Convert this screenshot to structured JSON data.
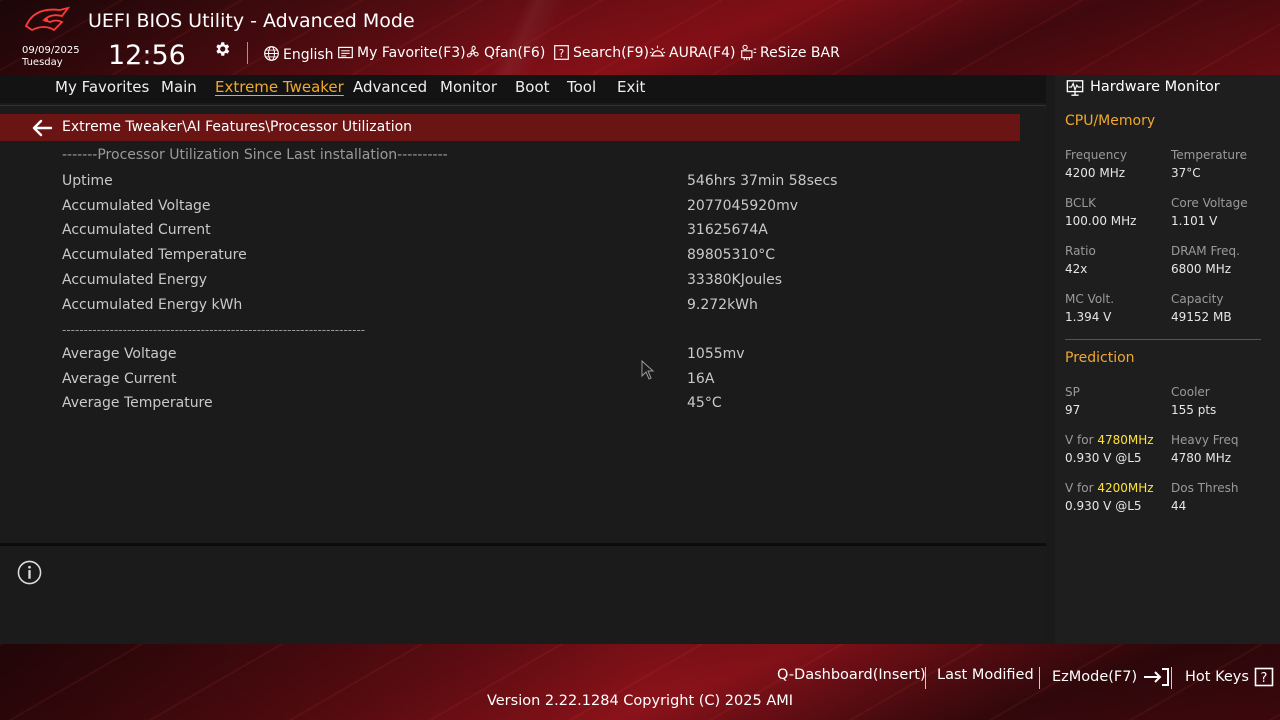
{
  "header": {
    "title": "UEFI BIOS Utility - Advanced Mode",
    "date": "09/09/2025",
    "day": "Tuesday",
    "time": "12:56",
    "toolbar": [
      {
        "label": "English",
        "icon": "globe-icon"
      },
      {
        "label": "My Favorite(F3)",
        "icon": "favorite-icon"
      },
      {
        "label": "Qfan(F6)",
        "icon": "fan-icon"
      },
      {
        "label": "Search(F9)",
        "icon": "search-icon"
      },
      {
        "label": "AURA(F4)",
        "icon": "aura-icon"
      },
      {
        "label": "ReSize BAR",
        "icon": "resize-bar-icon"
      }
    ]
  },
  "tabs": [
    "My Favorites",
    "Main",
    "Extreme Tweaker",
    "Advanced",
    "Monitor",
    "Boot",
    "Tool",
    "Exit"
  ],
  "active_tab": "Extreme Tweaker",
  "breadcrumb": "Extreme Tweaker\\AI Features\\Processor Utilization",
  "section_header": "-------Processor Utilization Since Last installation----------",
  "rows_top": [
    {
      "label": "Uptime",
      "value": "546hrs 37min 58secs"
    },
    {
      "label": "Accumulated Voltage",
      "value": "2077045920mv"
    },
    {
      "label": "Accumulated Current",
      "value": "31625674A"
    },
    {
      "label": "Accumulated Temperature",
      "value": "89805310°C"
    },
    {
      "label": "Accumulated Energy",
      "value": "33380KJoules"
    },
    {
      "label": "Accumulated Energy kWh",
      "value": "9.272kWh"
    }
  ],
  "divider_text": "----------------------------------------------------------------------",
  "rows_bottom": [
    {
      "label": "Average Voltage",
      "value": "1055mv"
    },
    {
      "label": "Average Current",
      "value": "16A"
    },
    {
      "label": "Average Temperature",
      "value": "45°C"
    }
  ],
  "hardware_monitor": {
    "title": "Hardware Monitor",
    "cpu_memory": {
      "heading": "CPU/Memory",
      "items": [
        {
          "label": "Frequency",
          "value": "4200 MHz"
        },
        {
          "label": "Temperature",
          "value": "37°C"
        },
        {
          "label": "BCLK",
          "value": "100.00 MHz"
        },
        {
          "label": "Core Voltage",
          "value": "1.101 V"
        },
        {
          "label": "Ratio",
          "value": "42x"
        },
        {
          "label": "DRAM Freq.",
          "value": "6800 MHz"
        },
        {
          "label": "MC Volt.",
          "value": "1.394 V"
        },
        {
          "label": "Capacity",
          "value": "49152 MB"
        }
      ]
    },
    "prediction": {
      "heading": "Prediction",
      "sp_label": "SP",
      "sp_value": "97",
      "cooler_label": "Cooler",
      "cooler_value": "155 pts",
      "v1_prefix": "V for ",
      "v1_freq": "4780MHz",
      "v1_value": "0.930 V @L5",
      "heavy_label": "Heavy Freq",
      "heavy_value": "4780 MHz",
      "v2_prefix": "V for ",
      "v2_freq": "4200MHz",
      "v2_value": "0.930 V @L5",
      "dos_label": "Dos Thresh",
      "dos_value": "44"
    }
  },
  "footer": {
    "buttons": [
      "Q-Dashboard(Insert)",
      "Last Modified",
      "EzMode(F7)",
      "Hot Keys"
    ],
    "version": "Version 2.22.1284 Copyright (C) 2025 AMI"
  },
  "colors": {
    "accent": "#f0a830",
    "breadcrumb_bg": "#6a1414",
    "highlight": "#ffe23a"
  }
}
